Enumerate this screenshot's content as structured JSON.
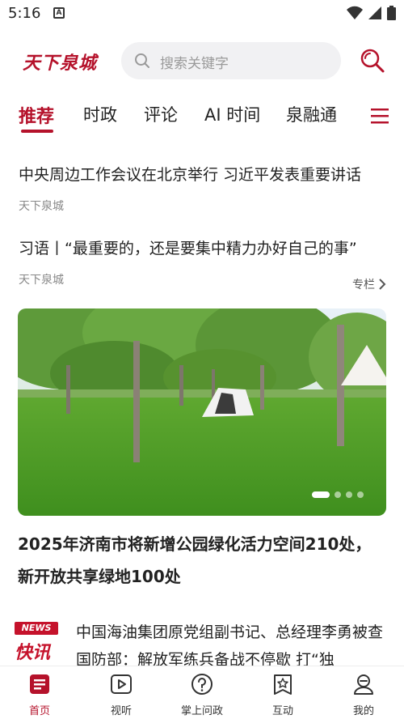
{
  "status_bar": {
    "time": "5:16"
  },
  "header": {
    "logo": "天下泉城",
    "search_placeholder": "搜索关键字"
  },
  "tabs": [
    {
      "label": "推荐",
      "active": true
    },
    {
      "label": "时政",
      "active": false
    },
    {
      "label": "评论",
      "active": false
    },
    {
      "label": "AI 时间",
      "active": false
    },
    {
      "label": "泉融通",
      "active": false
    }
  ],
  "news": [
    {
      "headline": "中央周边工作会议在北京举行 习近平发表重要讲话",
      "source": "天下泉城"
    },
    {
      "headline": "习语丨“最重要的，还是要集中精力办好自己的事”",
      "source": "天下泉城",
      "link": "专栏"
    }
  ],
  "banner": {
    "slides": 4,
    "active_slide": 1
  },
  "feature": {
    "title": "2025年济南市将新增公园绿化活力空间210处，新开放共享绿地100处"
  },
  "list_item": {
    "badge": "NEWS",
    "badge_title": "快讯",
    "line1": "中国海油集团原党组副书记、总经理李勇被查",
    "line2": "国防部：解放军练兵备战不停歇 打“独"
  },
  "bottom_nav": [
    {
      "label": "首页",
      "icon": "home-icon",
      "active": true
    },
    {
      "label": "视听",
      "icon": "play-icon",
      "active": false
    },
    {
      "label": "掌上问政",
      "icon": "question-icon",
      "active": false
    },
    {
      "label": "互动",
      "icon": "star-card-icon",
      "active": false
    },
    {
      "label": "我的",
      "icon": "profile-icon",
      "active": false
    }
  ],
  "colors": {
    "accent": "#b5122b",
    "search_bg": "#f1f1f3",
    "text": "#222222",
    "muted": "#888888"
  }
}
